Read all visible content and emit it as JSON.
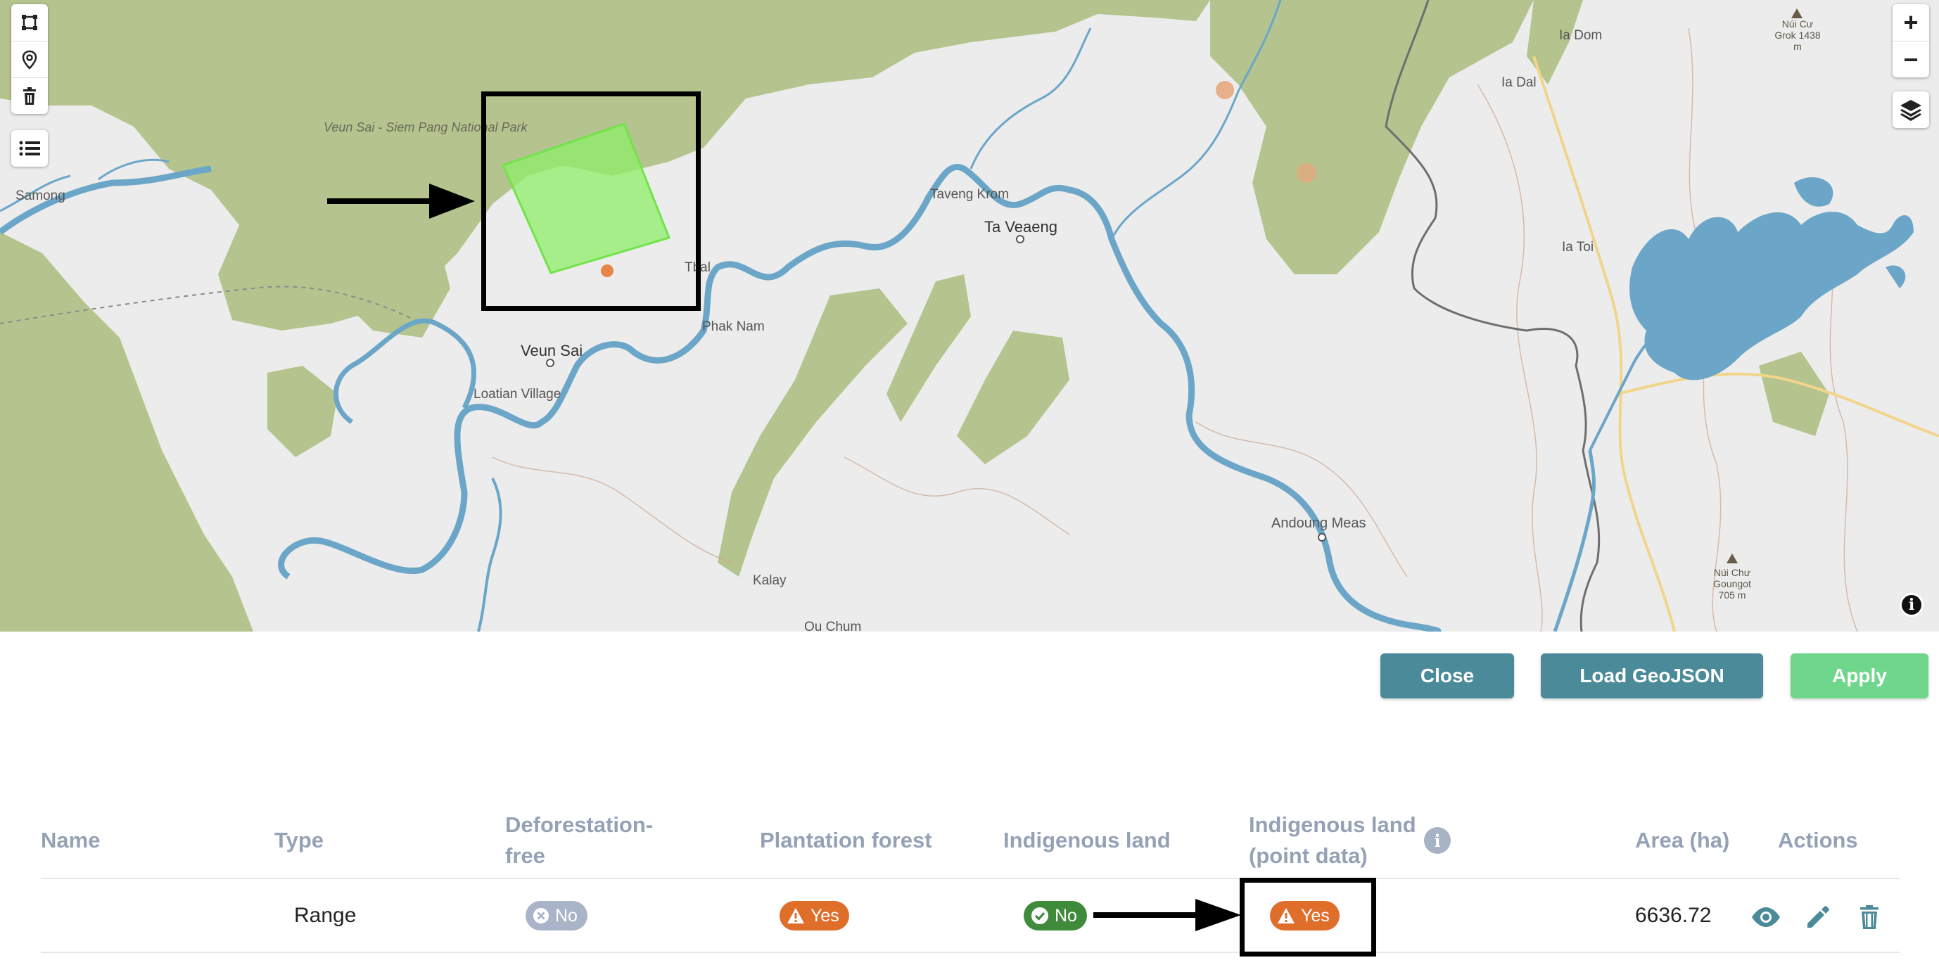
{
  "map": {
    "place_labels": {
      "samong": "Samong",
      "veun_sai_park": "Veun Sai - Siem Pang National Park",
      "taveng_krom": "Taveng Krom",
      "ta_veaeng": "Ta Veaeng",
      "tbal": "Tbal",
      "phak_nam": "Phak Nam",
      "veun_sai": "Veun Sai",
      "loatian_village": "Loatian Village",
      "kalay": "Kalay",
      "ou_chum": "Ou Chum",
      "andoung_meas": "Andoung Meas",
      "ia_dom": "Ia Dom",
      "ia_dal": "Ia Dal",
      "ia_toi": "Ia Toi",
      "nui_cu_grok": "Núi Cư Grok 1438 m",
      "nui_chu_goungot": "Núi Chư Goungot 705 m"
    },
    "controls": {
      "draw_polygon_icon": "polygon-draw-icon",
      "marker_icon": "map-pin-icon",
      "delete_icon": "trash-icon",
      "list_icon": "list-icon",
      "zoom_in_label": "+",
      "zoom_out_label": "−",
      "layers_icon": "layers-icon",
      "info_label": "i"
    },
    "colors": {
      "forest": "#b5c48e",
      "water": "#6ba6c8",
      "land": "#ececec",
      "polygon_fill": "#8fef6a",
      "point": "#e8a57a"
    }
  },
  "buttons": {
    "close": "Close",
    "load_geojson": "Load GeoJSON",
    "apply": "Apply"
  },
  "table": {
    "headers": {
      "name": "Name",
      "type": "Type",
      "deforestation_free": "Deforestation-free",
      "plantation_forest": "Plantation forest",
      "indigenous_land": "Indigenous land",
      "indigenous_land_point": "Indigenous land (point data)",
      "area": "Area (ha)",
      "actions": "Actions"
    },
    "rows": [
      {
        "name": "",
        "type": "Range",
        "deforestation_free": "No",
        "plantation_forest": "Yes",
        "indigenous_land": "No",
        "indigenous_land_point": "Yes",
        "area": "6636.72",
        "actions": [
          "eye-icon",
          "pencil-icon",
          "trash-icon"
        ]
      }
    ]
  }
}
